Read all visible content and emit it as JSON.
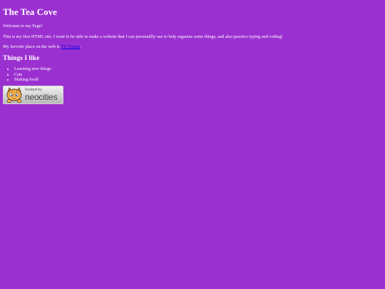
{
  "page": {
    "title": "The Tea Cove",
    "welcome": "Welcome to my Page!",
    "intro": "This is my first HTML site. I want to be able to make a website that I can personallly use to help organize some things, and also practice typing and coding!",
    "favorite": {
      "prefix": "My favorite place on the web is ",
      "link_text": "TV Tropes",
      "suffix": "."
    },
    "things_heading": "Things I like",
    "things": [
      "Learning new things",
      "Cats",
      "Making food!"
    ]
  },
  "badge": {
    "small_text": "hosted by",
    "big_text": "neocities",
    "icon": "neocities-cat-icon"
  },
  "colors": {
    "background": "#9b30d0",
    "text": "#ffffff",
    "link": "#0000ee"
  }
}
